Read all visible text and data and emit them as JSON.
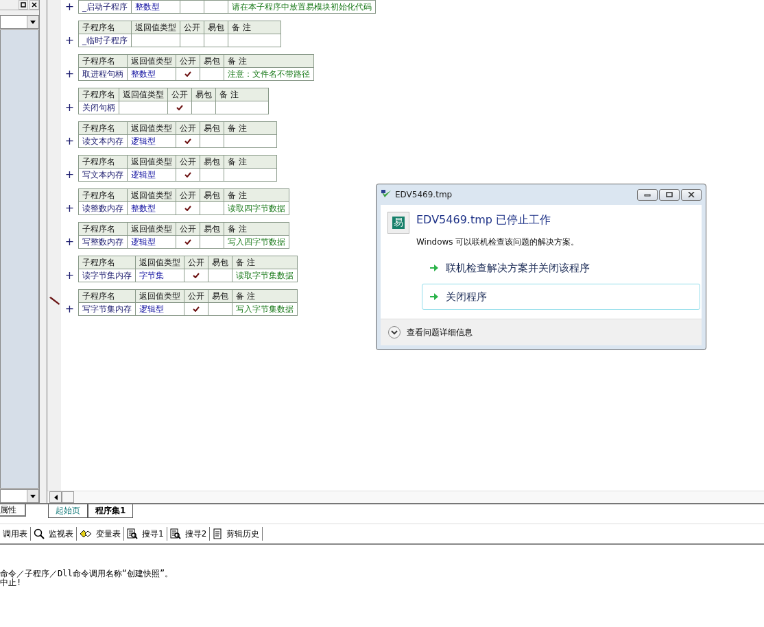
{
  "left_panel": {
    "tab": "属性"
  },
  "procedures": [
    {
      "kind": "row_only",
      "name": "_启动子程序",
      "return_type": "整数型",
      "public": false,
      "note": "请在本子程序中放置易模块初始化代码"
    },
    {
      "kind": "full",
      "headers": [
        "子程序名",
        "返回值类型",
        "公开",
        "易包",
        "备 注"
      ],
      "name": "_临时子程序",
      "public": false
    },
    {
      "kind": "full",
      "headers": [
        "子程序名",
        "返回值类型",
        "公开",
        "易包",
        "备 注"
      ],
      "name": "取进程句柄",
      "return_type": "整数型",
      "public": true,
      "note": "注意：文件名不带路径"
    },
    {
      "kind": "full",
      "headers": [
        "子程序名",
        "返回值类型",
        "公开",
        "易包",
        "备 注"
      ],
      "name": "关闭句柄",
      "public": true
    },
    {
      "kind": "full",
      "headers": [
        "子程序名",
        "返回值类型",
        "公开",
        "易包",
        "备 注"
      ],
      "name": "读文本内存",
      "return_type": "逻辑型",
      "public": true
    },
    {
      "kind": "full",
      "headers": [
        "子程序名",
        "返回值类型",
        "公开",
        "易包",
        "备 注"
      ],
      "name": "写文本内存",
      "return_type": "逻辑型",
      "public": true
    },
    {
      "kind": "full",
      "headers": [
        "子程序名",
        "返回值类型",
        "公开",
        "易包",
        "备 注"
      ],
      "name": "读整数内存",
      "return_type": "整数型",
      "public": true,
      "note": "读取四字节数据"
    },
    {
      "kind": "full",
      "headers": [
        "子程序名",
        "返回值类型",
        "公开",
        "易包",
        "备 注"
      ],
      "name": "写整数内存",
      "return_type": "逻辑型",
      "public": true,
      "note": "写入四字节数据"
    },
    {
      "kind": "full",
      "headers": [
        "子程序名",
        "返回值类型",
        "公开",
        "易包",
        "备 注"
      ],
      "name": "读字节集内存",
      "return_type": "字节集",
      "public": true,
      "note": "读取字节集数据"
    },
    {
      "kind": "full",
      "headers": [
        "子程序名",
        "返回值类型",
        "公开",
        "易包",
        "备 注"
      ],
      "name": "写字节集内存",
      "return_type": "逻辑型",
      "public": true,
      "note": "写入字节集数据",
      "marked": true
    }
  ],
  "plus_sign": "+",
  "editor_tabs": [
    {
      "label": "起始页",
      "selected": false
    },
    {
      "label": "程序集1",
      "selected": true
    }
  ],
  "toolbar": [
    "调用表",
    "监视表",
    "变量表",
    "搜寻1",
    "搜寻2",
    "剪辑历史"
  ],
  "output_lines": [
    "命令／子程序／Dll命令调用名称“创建快照”。",
    "中止!"
  ],
  "dialog": {
    "title": "EDV5469.tmp",
    "heading": "EDV5469.tmp 已停止工作",
    "message": "Windows 可以联机检查该问题的解决方案。",
    "options": [
      {
        "label": "联机检查解决方案并关闭该程序",
        "selected": false
      },
      {
        "label": "关闭程序",
        "selected": true
      }
    ],
    "details": "查看问题详细信息",
    "logo_char": "易"
  }
}
